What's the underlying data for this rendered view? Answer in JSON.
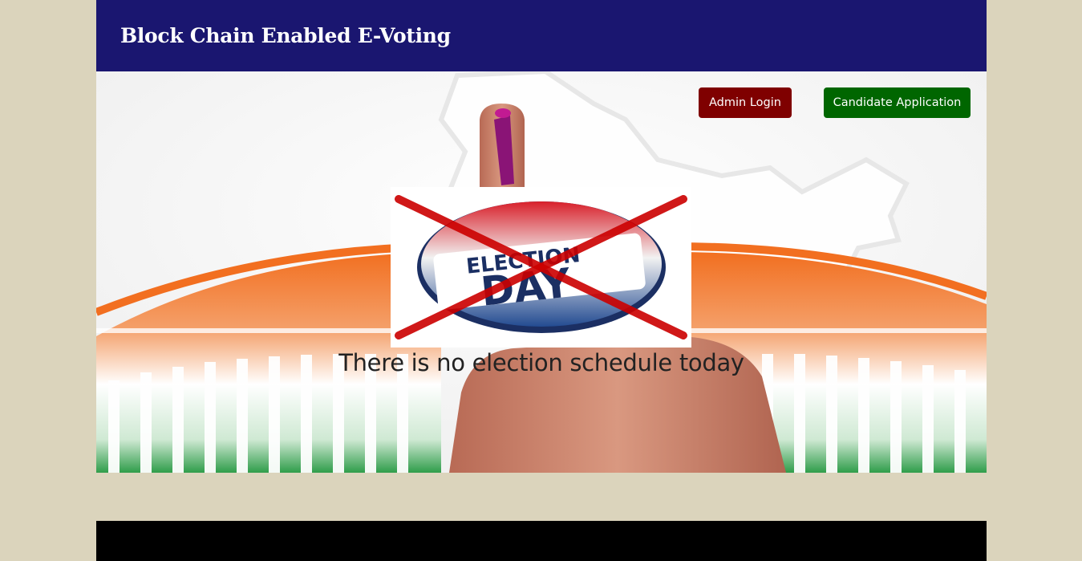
{
  "header": {
    "title": "Block Chain Enabled E-Voting"
  },
  "actions": {
    "admin_login": "Admin Login",
    "candidate_application": "Candidate Application"
  },
  "banner": {
    "badge_line1": "ELECTION",
    "badge_line2": "DAY"
  },
  "main": {
    "message": "There is no election schedule today"
  },
  "colors": {
    "header_bg": "#1a1670",
    "page_bg": "#dbd4bc",
    "admin_button": "#7f0000",
    "candidate_button": "#006600",
    "footer_bg": "#000000"
  }
}
